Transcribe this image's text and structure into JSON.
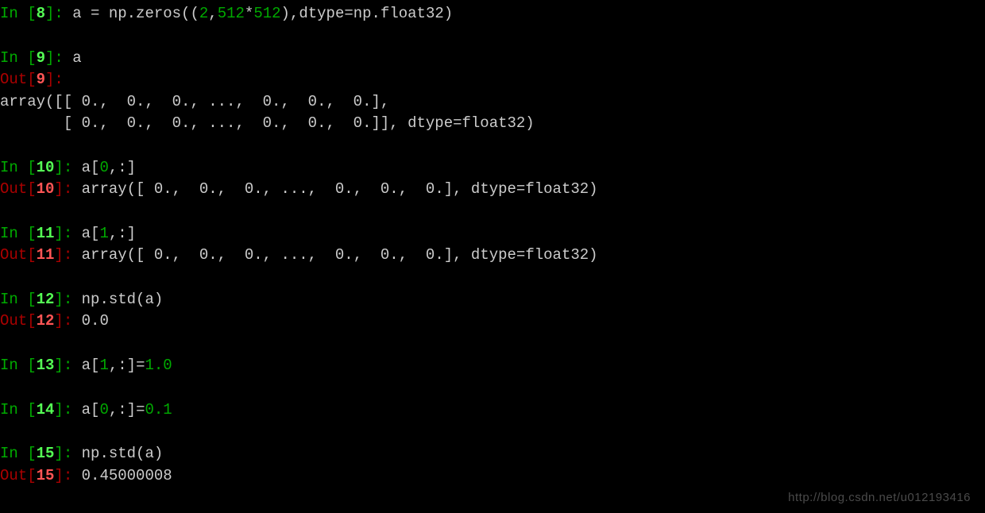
{
  "cells": {
    "c8": {
      "in_prompt": "In [",
      "in_close": "]: ",
      "num": "8",
      "code_pre": "a = np.zeros((",
      "n1": "2",
      "sep1": ",",
      "n2": "512",
      "op": "*",
      "n3": "512",
      "code_post": "),dtype=np.float32)"
    },
    "c9": {
      "in_prompt": "In [",
      "in_close": "]: ",
      "num": "9",
      "code": "a",
      "out_prompt": "Out[",
      "out_close": "]: ",
      "out_line1": "array([[ 0.,  0.,  0., ...,  0.,  0.,  0.],",
      "out_line2": "       [ 0.,  0.,  0., ...,  0.,  0.,  0.]], dtype=float32)"
    },
    "c10": {
      "in_prompt": "In [",
      "in_close": "]: ",
      "num": "10",
      "code_pre": "a[",
      "idx": "0",
      "code_post": ",:]",
      "out_prompt": "Out[",
      "out_close": "]: ",
      "out": "array([ 0.,  0.,  0., ...,  0.,  0.,  0.], dtype=float32)"
    },
    "c11": {
      "in_prompt": "In [",
      "in_close": "]: ",
      "num": "11",
      "code_pre": "a[",
      "idx": "1",
      "code_post": ",:]",
      "out_prompt": "Out[",
      "out_close": "]: ",
      "out": "array([ 0.,  0.,  0., ...,  0.,  0.,  0.], dtype=float32)"
    },
    "c12": {
      "in_prompt": "In [",
      "in_close": "]: ",
      "num": "12",
      "code": "np.std(a)",
      "out_prompt": "Out[",
      "out_close": "]: ",
      "out": "0.0"
    },
    "c13": {
      "in_prompt": "In [",
      "in_close": "]: ",
      "num": "13",
      "code_pre": "a[",
      "idx": "1",
      "mid": ",:]=",
      "val": "1.0"
    },
    "c14": {
      "in_prompt": "In [",
      "in_close": "]: ",
      "num": "14",
      "code_pre": "a[",
      "idx": "0",
      "mid": ",:]=",
      "val": "0.1"
    },
    "c15": {
      "in_prompt": "In [",
      "in_close": "]: ",
      "num": "15",
      "code": "np.std(a)",
      "out_prompt": "Out[",
      "out_close": "]: ",
      "out": "0.45000008"
    }
  },
  "watermark": "http://blog.csdn.net/u012193416"
}
